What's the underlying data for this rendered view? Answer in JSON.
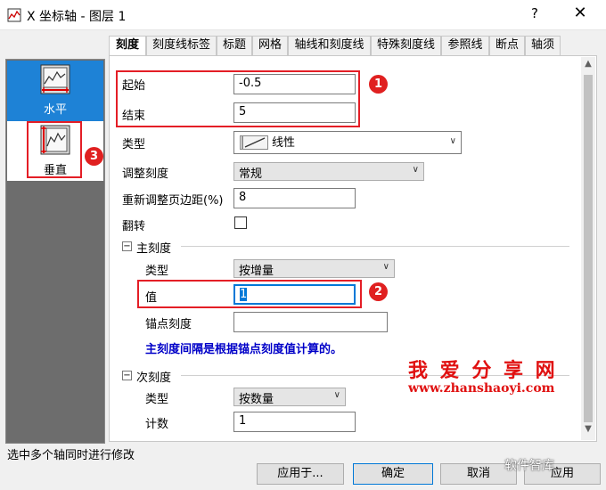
{
  "window": {
    "title": "X 坐标轴 - 图层 1",
    "help": "?",
    "close": "✕"
  },
  "axes": [
    {
      "label": "水平",
      "selected": true
    },
    {
      "label": "垂直",
      "selected": false
    }
  ],
  "tabs": [
    "刻度",
    "刻度线标签",
    "标题",
    "网格",
    "轴线和刻度线",
    "特殊刻度线",
    "参照线",
    "断点",
    "轴须"
  ],
  "scale": {
    "from_label": "起始",
    "from_value": "-0.5",
    "to_label": "结束",
    "to_value": "5",
    "type_label": "类型",
    "type_value": "线性",
    "rescale_label": "调整刻度",
    "rescale_value": "常规",
    "margin_label": "重新调整页边距(%)",
    "margin_value": "8",
    "reverse_label": "翻转"
  },
  "major": {
    "header": "主刻度",
    "type_label": "类型",
    "type_value": "按增量",
    "value_label": "值",
    "value_value": "1",
    "anchor_label": "锚点刻度",
    "anchor_value": "",
    "hint": "主刻度间隔是根据锚点刻度值计算的。"
  },
  "minor": {
    "header": "次刻度",
    "type_label": "类型",
    "type_value": "按数量",
    "count_label": "计数",
    "count_value": "1"
  },
  "annotations": {
    "badge1": "1",
    "badge2": "2",
    "badge3": "3"
  },
  "watermark": {
    "title": "我 爱 分 享 网",
    "url": "www.zhanshaoyi.com",
    "brand": "软件智库"
  },
  "footer": {
    "status": "选中多个轴同时进行修改",
    "apply_to": "应用于...",
    "ok": "确定",
    "cancel": "取消",
    "apply": "应用"
  },
  "colors": {
    "accent": "#1e82d6",
    "annotation_red": "#e41e26",
    "hint_blue": "#0000c8"
  }
}
